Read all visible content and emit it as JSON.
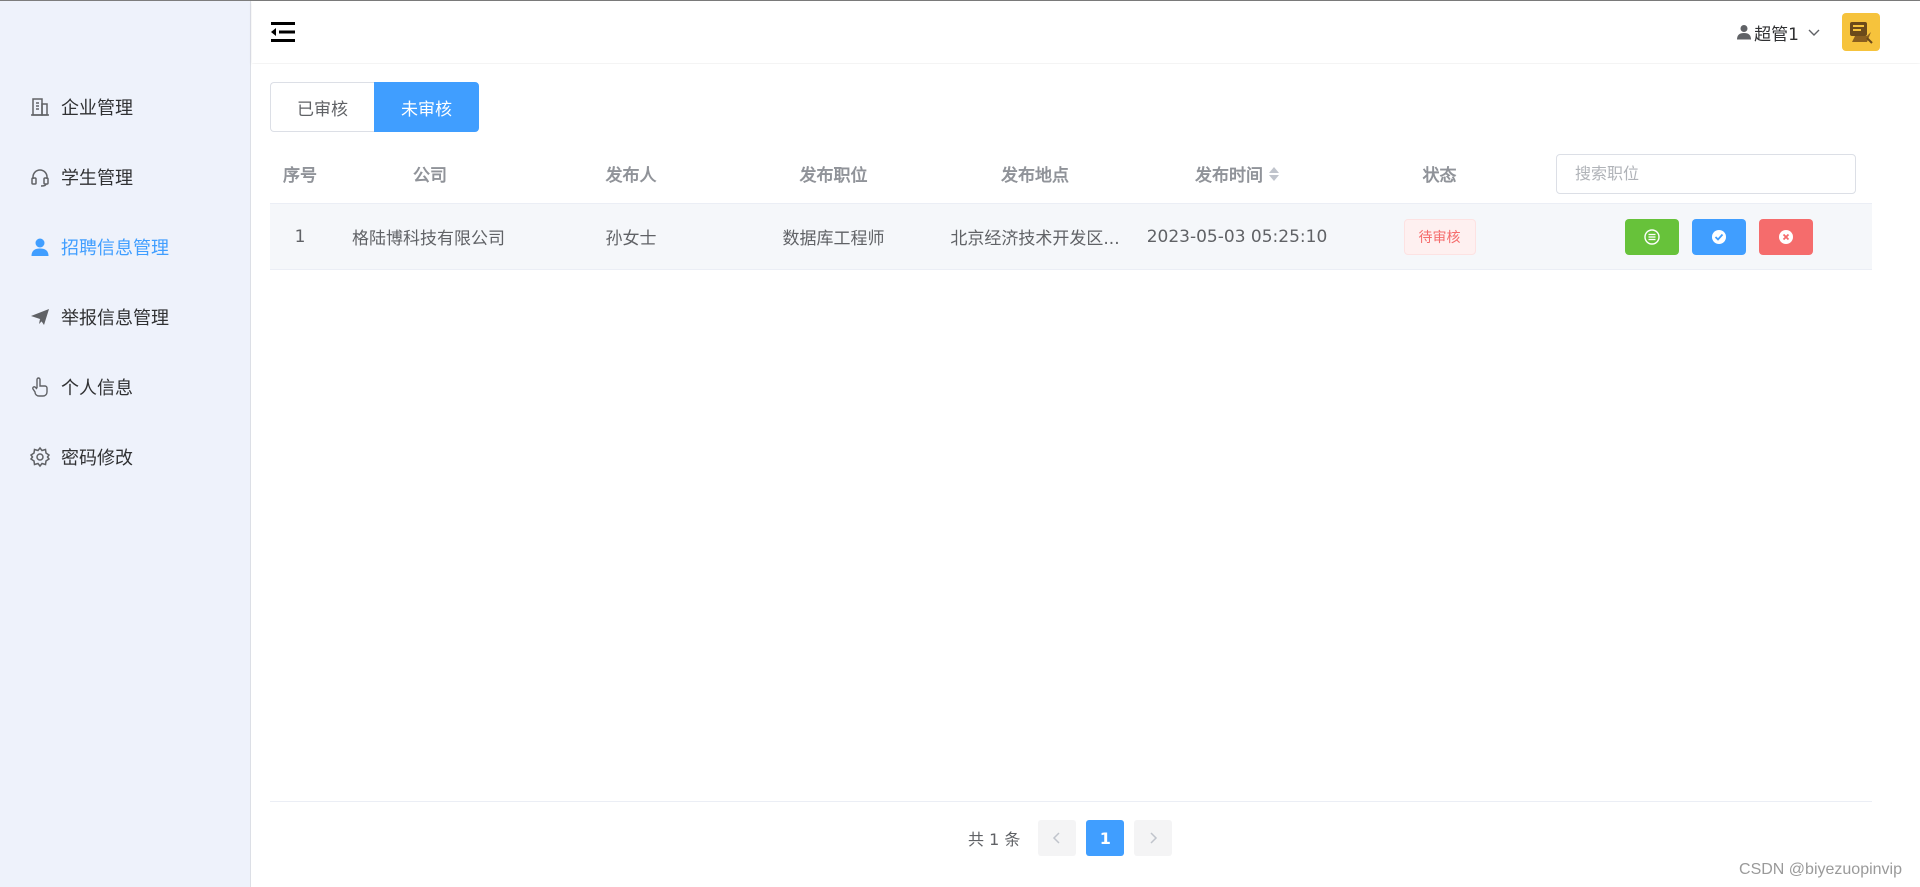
{
  "sidebar": {
    "items": [
      {
        "label": "企业管理",
        "icon": "building-icon",
        "active": false
      },
      {
        "label": "学生管理",
        "icon": "headset-icon",
        "active": false
      },
      {
        "label": "招聘信息管理",
        "icon": "user-icon",
        "active": true
      },
      {
        "label": "举报信息管理",
        "icon": "paper-plane-icon",
        "active": false
      },
      {
        "label": "个人信息",
        "icon": "pointer-hand-icon",
        "active": false
      },
      {
        "label": "密码修改",
        "icon": "gear-icon",
        "active": false
      }
    ]
  },
  "header": {
    "username": "超管1",
    "menu_icon": "collapse-menu-icon"
  },
  "tabs": [
    {
      "label": "已审核",
      "active": false
    },
    {
      "label": "未审核",
      "active": true
    }
  ],
  "table": {
    "columns": [
      "序号",
      "公司",
      "发布人",
      "发布职位",
      "发布地点",
      "发布时间",
      "状态"
    ],
    "search_placeholder": "搜索职位",
    "rows": [
      {
        "index": "1",
        "company": "格陆博科技有限公司",
        "publisher": "孙女士",
        "position": "数据库工程师",
        "location": "北京经济技术开发区...",
        "time": "2023-05-03 05:25:10",
        "status": "待审核"
      }
    ]
  },
  "pagination": {
    "total": "共 1 条",
    "current": "1"
  },
  "watermark": "CSDN @biyezuopinvip",
  "colors": {
    "primary": "#409eff",
    "success": "#67c23a",
    "danger": "#f56c6c",
    "sidebar_bg": "#eef2fb"
  }
}
